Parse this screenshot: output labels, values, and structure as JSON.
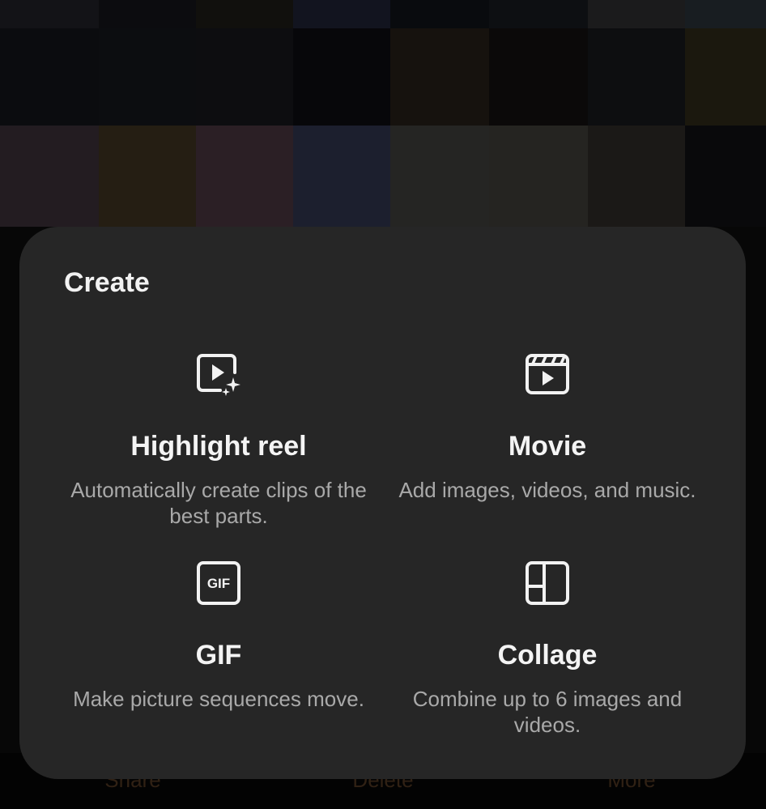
{
  "sheet": {
    "title": "Create",
    "options": [
      {
        "label": "Highlight reel",
        "description": "Automatically create clips of the best parts.",
        "icon": "highlight-reel-icon"
      },
      {
        "label": "Movie",
        "description": "Add images, videos, and music.",
        "icon": "movie-clapper-icon"
      },
      {
        "label": "GIF",
        "description": "Make picture sequences move.",
        "icon": "gif-icon",
        "icon_text": "GIF"
      },
      {
        "label": "Collage",
        "description": "Combine up to 6 images and videos.",
        "icon": "collage-icon"
      }
    ]
  },
  "bottom_bar": {
    "share": "Share",
    "delete": "Delete",
    "more": "More"
  },
  "colors": {
    "sheet_background": "#262626",
    "title_text": "#f2f2f2",
    "description_text": "#a9a9a9"
  }
}
